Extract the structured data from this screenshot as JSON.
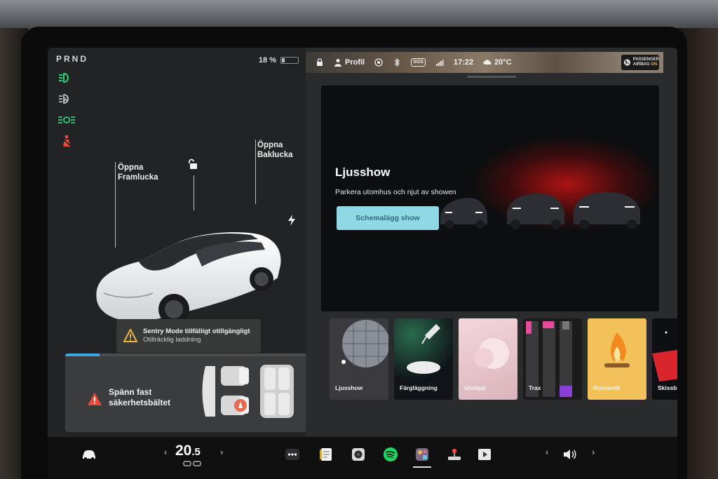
{
  "drive": {
    "gears": "PRND"
  },
  "battery": {
    "percent_label": "18 %",
    "level": 0.18
  },
  "telltales": [
    "low-beam-icon",
    "auto-headlight-icon",
    "parking-lights-icon",
    "seatbelt-warning-icon"
  ],
  "car_controls": {
    "front_trunk": {
      "line1": "Öppna",
      "line2": "Framlucka"
    },
    "rear_trunk": {
      "line1": "Öppna",
      "line2": "Baklucka"
    }
  },
  "sentry_alert": {
    "title": "Sentry Mode tillfälligt otillgängligt",
    "subtitle": "Otillräcklig laddning"
  },
  "seatbelt_alert": {
    "line1": "Spänn fast",
    "line2": "säkerhetsbältet",
    "progress": 0.14
  },
  "status_bar": {
    "profile_label": "Profil",
    "sos_label": "SOS",
    "time": "17:22",
    "temperature": "20°C",
    "airbag_line1": "PASSENGER",
    "airbag_line2": "AIRBAG",
    "airbag_state": "ON"
  },
  "light_show": {
    "title": "Ljusshow",
    "subtitle": "Parkera utomhus och njut av showen",
    "button_label": "Schemalägg show"
  },
  "toybox_tiles": [
    {
      "label": "Ljusshow",
      "icon": "disco-ball-icon"
    },
    {
      "label": "Färgläggning",
      "icon": "color-dropper-icon"
    },
    {
      "label": "Utsläpp",
      "icon": "emissions-icon"
    },
    {
      "label": "Trax",
      "icon": "trax-icon"
    },
    {
      "label": "Romantik",
      "icon": "fireplace-icon"
    },
    {
      "label": "Skissblock",
      "icon": "sketchpad-icon"
    }
  ],
  "dock": {
    "cabin_temp_whole": "20",
    "cabin_temp_decimal": ".5",
    "left_arrow": "‹",
    "right_arrow": "›",
    "volume_left": "‹",
    "volume_right": "›",
    "apps": [
      "more-apps-icon",
      "notes-icon",
      "camera-icon",
      "spotify-icon",
      "toybox-icon",
      "arcade-icon",
      "theater-icon"
    ]
  },
  "colors": {
    "accent_teal": "#8fd8e6",
    "telltale_green": "#2fd27a",
    "alert_red": "#e84a3c",
    "progress_blue": "#3ba7e6"
  }
}
